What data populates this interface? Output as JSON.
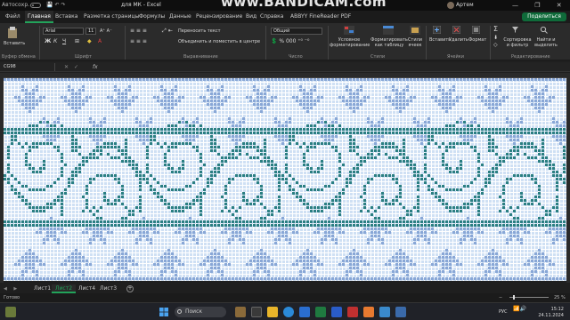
{
  "titlebar": {
    "autosave": "Автосохр.",
    "title": "для МК  -  Excel",
    "watermark": "www.BANDICAM.com",
    "user": "Артем",
    "window_controls": "—  ❐  ✕"
  },
  "menu": {
    "tabs": [
      "Файл",
      "Главная",
      "Вставка",
      "Разметка страницы",
      "Формулы",
      "Данные",
      "Рецензирование",
      "Вид",
      "Справка",
      "ABBYY FineReader PDF"
    ],
    "active_tab": "Главная",
    "share": "Поделиться"
  },
  "ribbon": {
    "clipboard": {
      "paste": "Вставить",
      "group": "Буфер обмена"
    },
    "font": {
      "name": "Arial",
      "size": "11",
      "group": "Шрифт"
    },
    "alignment": {
      "wrap": "Переносить текст",
      "merge": "Объединить и поместить в центре",
      "group": "Выравнивание"
    },
    "number": {
      "format": "Общий",
      "group": "Число"
    },
    "styles": {
      "conditional": "Условное форматирование",
      "as_table": "Форматировать как таблицу",
      "cell_styles": "Стили ячеек",
      "group": "Стили"
    },
    "cells": {
      "insert": "Вставить",
      "delete": "Удалить",
      "format": "Формат",
      "group": "Ячейки"
    },
    "editing": {
      "sort": "Сортировка и фильтр",
      "find": "Найти и выделить",
      "group": "Редактирование"
    }
  },
  "formula": {
    "name_box": "CG98",
    "fx": "fx",
    "value": ""
  },
  "sheets": {
    "tabs": [
      "Лист1",
      "Лист2",
      "Лист4",
      "Лист3"
    ],
    "active": "Лист2"
  },
  "status": {
    "ready": "Готово",
    "zoom_pct": "25 %"
  },
  "taskbar": {
    "search": "Поиск",
    "lang": "РУС",
    "time": "15:12",
    "date": "24.11.2024"
  },
  "colors": {
    "pattern_teal": "#2b7f82",
    "pattern_blue": "#89a7d6",
    "cell_bg": "#cfe0f4",
    "accent_green": "#22a35a"
  }
}
